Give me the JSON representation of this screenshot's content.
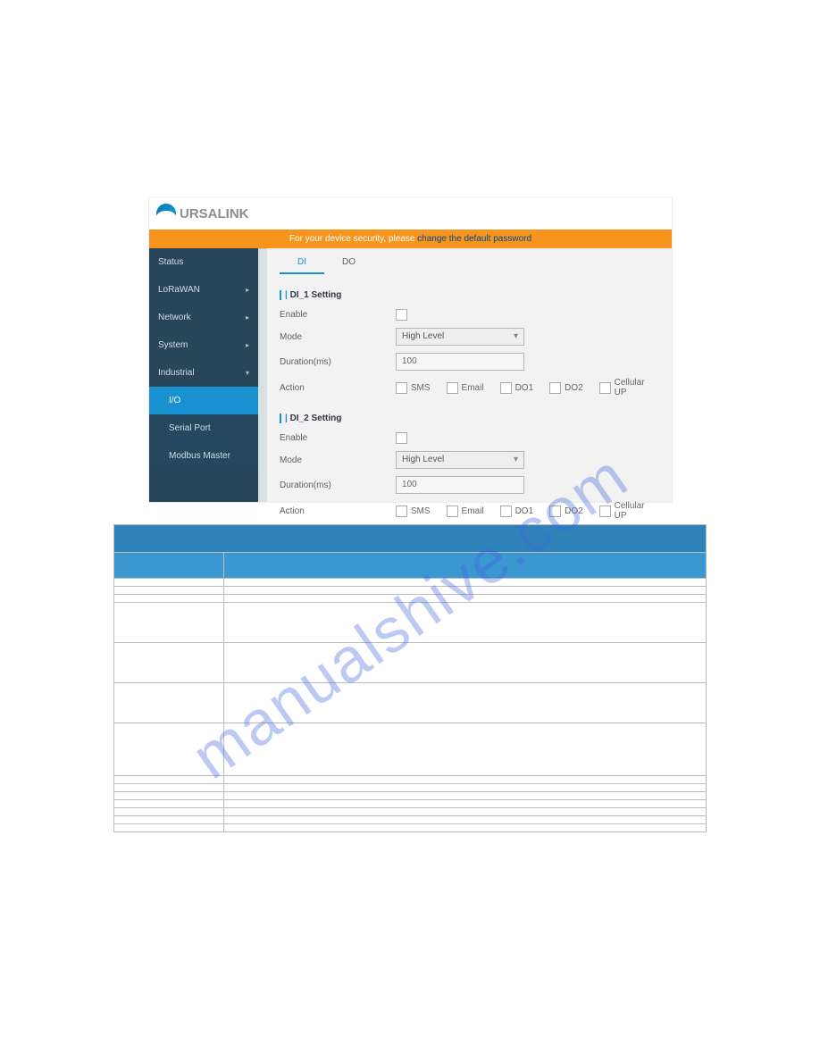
{
  "logo_text": "URSALINK",
  "alert": {
    "prefix": "For your device security, please ",
    "link": "change the default password"
  },
  "sidebar": {
    "items": [
      {
        "label": "Status",
        "expand": ""
      },
      {
        "label": "LoRaWAN",
        "expand": "▸"
      },
      {
        "label": "Network",
        "expand": "▸"
      },
      {
        "label": "System",
        "expand": "▸"
      },
      {
        "label": "Industrial",
        "expand": "▾"
      }
    ],
    "subs": [
      {
        "label": "I/O",
        "active": true
      },
      {
        "label": "Serial Port"
      },
      {
        "label": "Modbus Master"
      }
    ]
  },
  "tabs": {
    "di": "DI",
    "do": "DO"
  },
  "sections": [
    {
      "title": "DI_1 Setting",
      "enable_label": "Enable",
      "mode_label": "Mode",
      "mode_value": "High Level",
      "duration_label": "Duration(ms)",
      "duration_value": "100",
      "action_label": "Action",
      "actions": [
        "SMS",
        "Email",
        "DO1",
        "DO2",
        "Cellular UP"
      ]
    },
    {
      "title": "DI_2 Setting",
      "enable_label": "Enable",
      "mode_label": "Mode",
      "mode_value": "High Level",
      "duration_label": "Duration(ms)",
      "duration_value": "100",
      "action_label": "Action",
      "actions": [
        "SMS",
        "Email",
        "DO1",
        "DO2",
        "Cellular UP"
      ]
    }
  ],
  "watermark": "manualshive.com"
}
